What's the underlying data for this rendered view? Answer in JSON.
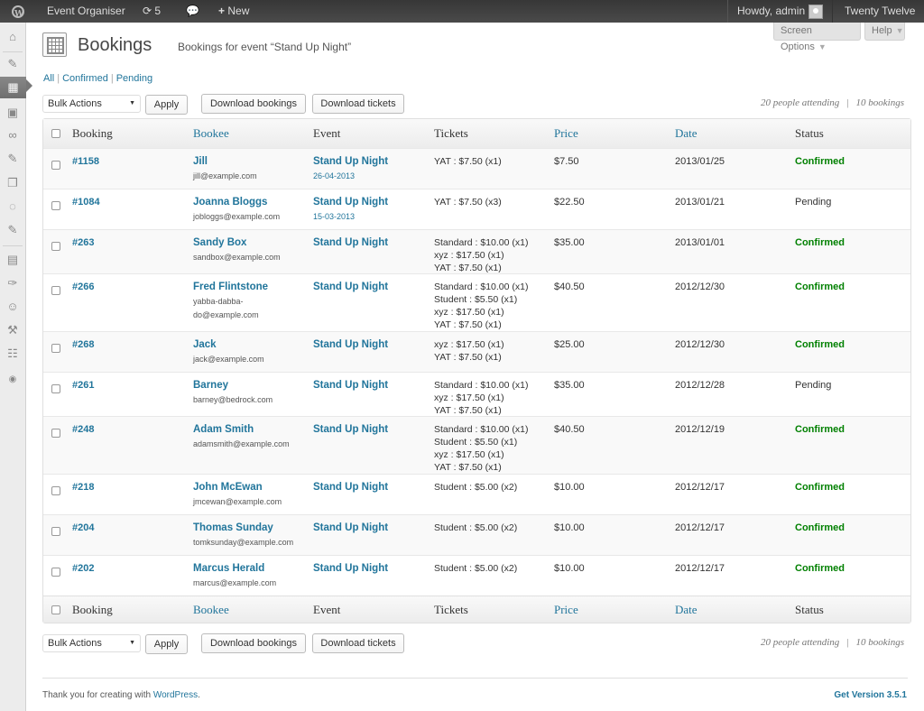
{
  "adminbar": {
    "site_name": "Event Organiser",
    "updates_count": "5",
    "new_label": "New",
    "howdy": "Howdy, admin",
    "theme": "Twenty Twelve"
  },
  "screen_meta": {
    "screen_options": "Screen Options",
    "help": "Help"
  },
  "header": {
    "title": "Bookings",
    "subtitle": "Bookings for event “Stand Up Night”"
  },
  "filters": {
    "all": "All",
    "confirmed": "Confirmed",
    "pending": "Pending"
  },
  "tablenav": {
    "bulk_actions": "Bulk Actions",
    "apply": "Apply",
    "download_bookings": "Download bookings",
    "download_tickets": "Download tickets",
    "people_attending": "20 people attending",
    "bookings_count": "10 bookings"
  },
  "columns": {
    "booking": "Booking",
    "bookee": "Bookee",
    "event": "Event",
    "tickets": "Tickets",
    "price": "Price",
    "date": "Date",
    "status": "Status"
  },
  "rows": [
    {
      "id": "#1158",
      "name": "Jill",
      "email": [
        "jill@example.com"
      ],
      "event": "Stand Up Night",
      "event_date": "26-04-2013",
      "tickets": [
        "YAT : $7.50 (x1)"
      ],
      "price": "$7.50",
      "date": "2013/01/25",
      "status": "Confirmed"
    },
    {
      "id": "#1084",
      "name": "Joanna Bloggs",
      "email": [
        "jobloggs@example.com"
      ],
      "event": "Stand Up Night",
      "event_date": "15-03-2013",
      "tickets": [
        "YAT : $7.50 (x3)"
      ],
      "price": "$22.50",
      "date": "2013/01/21",
      "status": "Pending"
    },
    {
      "id": "#263",
      "name": "Sandy Box",
      "email": [
        "sandbox@example.com"
      ],
      "event": "Stand Up Night",
      "event_date": "",
      "tickets": [
        "Standard : $10.00 (x1)",
        "xyz : $17.50 (x1)",
        "YAT : $7.50 (x1)"
      ],
      "price": "$35.00",
      "date": "2013/01/01",
      "status": "Confirmed"
    },
    {
      "id": "#266",
      "name": "Fred Flintstone",
      "email": [
        "yabba-dabba-",
        "do@example.com"
      ],
      "event": "Stand Up Night",
      "event_date": "",
      "tickets": [
        "Standard : $10.00 (x1)",
        "Student : $5.50 (x1)",
        "xyz : $17.50 (x1)",
        "YAT : $7.50 (x1)"
      ],
      "price": "$40.50",
      "date": "2012/12/30",
      "status": "Confirmed"
    },
    {
      "id": "#268",
      "name": "Jack",
      "email": [
        "jack@example.com"
      ],
      "event": "Stand Up Night",
      "event_date": "",
      "tickets": [
        "xyz : $17.50 (x1)",
        "YAT : $7.50 (x1)"
      ],
      "price": "$25.00",
      "date": "2012/12/30",
      "status": "Confirmed"
    },
    {
      "id": "#261",
      "name": "Barney",
      "email": [
        "barney@bedrock.com"
      ],
      "event": "Stand Up Night",
      "event_date": "",
      "tickets": [
        "Standard : $10.00 (x1)",
        "xyz : $17.50 (x1)",
        "YAT : $7.50 (x1)"
      ],
      "price": "$35.00",
      "date": "2012/12/28",
      "status": "Pending"
    },
    {
      "id": "#248",
      "name": "Adam Smith",
      "email": [
        "adamsmith@example.com"
      ],
      "event": "Stand Up Night",
      "event_date": "",
      "tickets": [
        "Standard : $10.00 (x1)",
        "Student : $5.50 (x1)",
        "xyz : $17.50 (x1)",
        "YAT : $7.50 (x1)"
      ],
      "price": "$40.50",
      "date": "2012/12/19",
      "status": "Confirmed"
    },
    {
      "id": "#218",
      "name": "John McEwan",
      "email": [
        "jmcewan@example.com"
      ],
      "event": "Stand Up Night",
      "event_date": "",
      "tickets": [
        "Student : $5.00 (x2)"
      ],
      "price": "$10.00",
      "date": "2012/12/17",
      "status": "Confirmed"
    },
    {
      "id": "#204",
      "name": "Thomas Sunday",
      "email": [
        "tomksunday@example.com"
      ],
      "event": "Stand Up Night",
      "event_date": "",
      "tickets": [
        "Student : $5.00 (x2)"
      ],
      "price": "$10.00",
      "date": "2012/12/17",
      "status": "Confirmed"
    },
    {
      "id": "#202",
      "name": "Marcus Herald",
      "email": [
        "marcus@example.com"
      ],
      "event": "Stand Up Night",
      "event_date": "",
      "tickets": [
        "Student : $5.00 (x2)"
      ],
      "price": "$10.00",
      "date": "2012/12/17",
      "status": "Confirmed"
    }
  ],
  "footer": {
    "thanks_prefix": "Thank you for creating with ",
    "wordpress": "WordPress",
    "thanks_suffix": ".",
    "version": "Get Version 3.5.1"
  },
  "colors": {
    "adminbar": "#464646",
    "link": "#21759b",
    "confirmed": "#008000",
    "sidebar": "#ececec"
  }
}
